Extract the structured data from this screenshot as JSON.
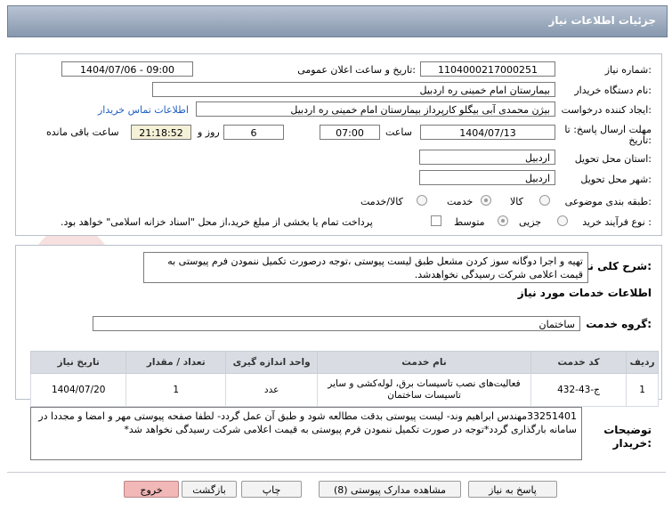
{
  "header": {
    "title": "جزئیات اطلاعات نیاز"
  },
  "details": {
    "need_number_label": "شماره نیاز:",
    "need_number": "1104000217000251",
    "announce_label": "تاریخ و ساعت اعلان عمومی:",
    "announce_value": "1404/07/06 - 09:00",
    "buyer_label": "نام دستگاه خریدار:",
    "buyer_value": "بیمارستان امام خمینی  ره  اردبیل",
    "creator_label": "ایجاد کننده درخواست:",
    "creator_value": "بیژن محمدی آبی بیگلو کارپرداز بیمارستان امام خمینی  ره  اردبیل",
    "contact_link": "اطلاعات تماس خریدار",
    "deadline_label": "مهلت ارسال پاسخ: تا",
    "deadline_label2": "تاریخ:",
    "deadline_date": "1404/07/13",
    "time_label": "ساعت",
    "deadline_time": "07:00",
    "days_value": "6",
    "days_label": "روز و",
    "remaining_time": "21:18:52",
    "remaining_label": "ساعت باقی مانده",
    "province_label": "استان محل تحویل:",
    "province_value": "اردبیل",
    "city_label": "شهر محل تحویل:",
    "city_value": "اردبیل",
    "category_label": "طبقه بندی موضوعی:",
    "category_options": [
      "کالا",
      "خدمت",
      "کالا/خدمت"
    ],
    "process_label": "نوع فرآیند خرید :",
    "process_options": [
      "جزیی",
      "متوسط"
    ],
    "payment_note": "پرداخت تمام یا بخشی از مبلغ خرید،از محل \"اسناد خزانه اسلامی\" خواهد بود."
  },
  "description": {
    "label": "شرح کلی نیاز:",
    "text": "تهیه و اجرا دوگانه سوز کردن مشعل طبق لیست پیوستی ،توجه درصورت تکمیل ننمودن فرم پیوستی به قیمت اعلامی شرکت رسیدگی نخواهدشد."
  },
  "services": {
    "section_title": "اطلاعات خدمات مورد نیاز",
    "group_label": "گروه خدمت:",
    "group_value": "ساختمان",
    "columns": [
      "ردیف",
      "کد خدمت",
      "نام خدمت",
      "واحد اندازه گیری",
      "تعداد / مقدار",
      "تاریخ نیاز"
    ],
    "rows": [
      {
        "row": "1",
        "code": "ج-43-432",
        "name_line1": "فعالیت‌های نصب تاسیسات برق، لوله‌کشی و سایر",
        "name_line2": "تاسیسات ساختمان",
        "unit": "عدد",
        "qty": "1",
        "date": "1404/07/20"
      }
    ]
  },
  "buyer_notes": {
    "label_line1": "توضیحات",
    "label_line2": "خریدار:",
    "text": "33251401مهندس ابراهیم وند- لیست پیوستی بدقت مطالعه شود و طبق آن عمل گردد- لطفا صفحه پیوستی مهر و امضا و مجددا در سامانه بارگذاری گردد*توجه در صورت تکمیل ننمودن فرم پیوستی به قیمت اعلامی شرکت رسیدگی نخواهد شد*"
  },
  "buttons": {
    "reply": "پاسخ به نیاز",
    "attachments": "مشاهده مدارک پیوستی (8)",
    "print": "چاپ",
    "back": "بازگشت",
    "exit": "خروج"
  },
  "watermark": {
    "text": "AriaTender.neT"
  },
  "colors": {
    "header": "#8797ad",
    "link": "#1f5fc2",
    "exit_button": "#f2b7b7",
    "table_header": "#d9dde3"
  }
}
